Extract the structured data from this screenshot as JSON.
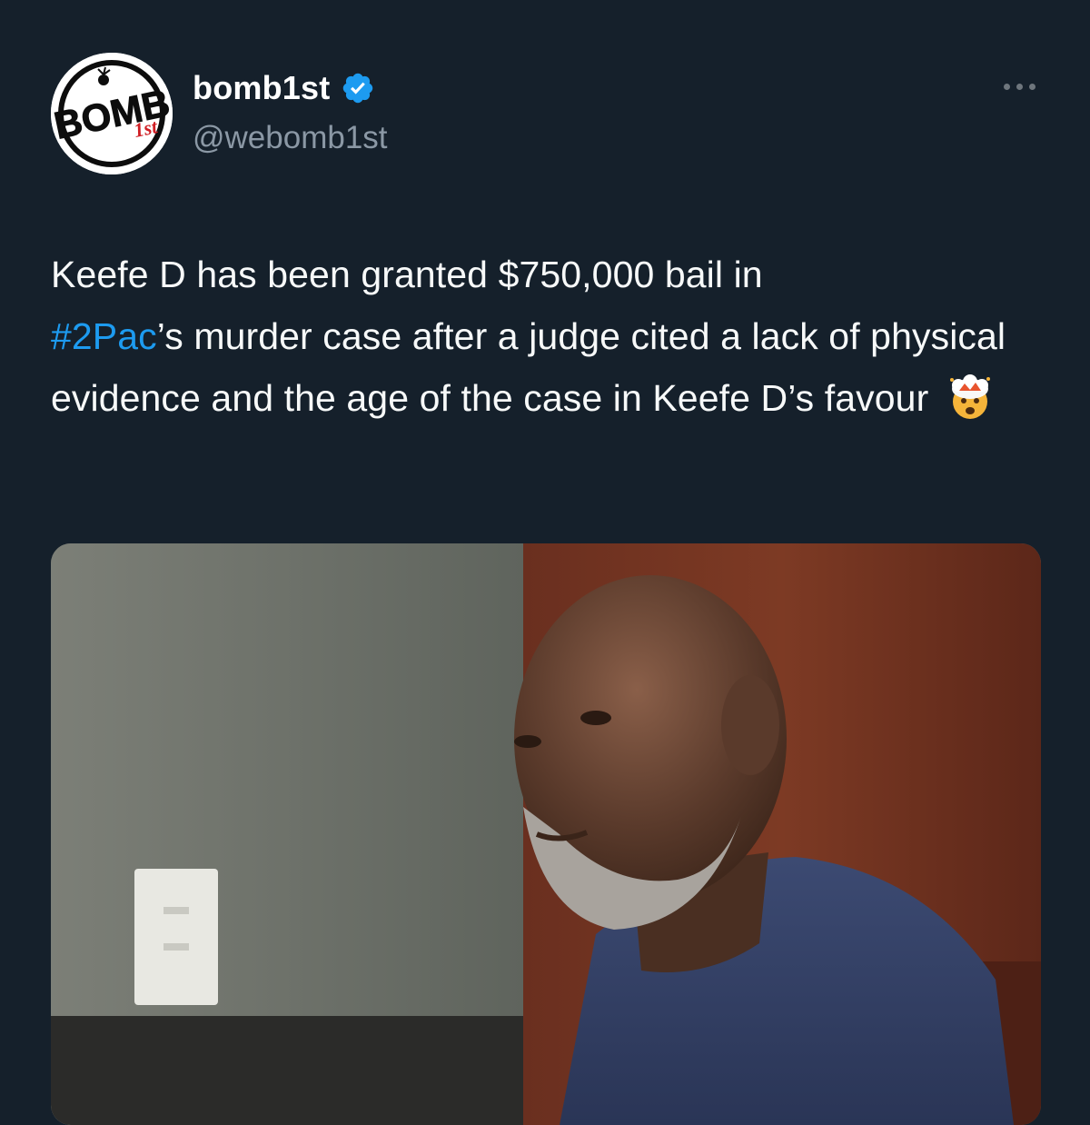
{
  "author": {
    "display_name": "bomb1st",
    "handle": "@webomb1st",
    "verified": true,
    "avatar_icon": "bomb1st-logo-icon",
    "avatar_logo_text": "BOMB",
    "avatar_logo_subtext": "1st"
  },
  "tweet": {
    "text_line1": "Keefe D has been granted $750,000 bail in",
    "hashtag": "#2Pac",
    "text_after_hashtag": "’s murder case after a judge cited a lack of physical evidence and the age of the case in Keefe D’s favour",
    "emoji": "exploding-head-emoji"
  },
  "media": {
    "type": "photo",
    "description_icon": "photo"
  },
  "colors": {
    "background": "#15202b",
    "text": "#f7f9f9",
    "secondary_text": "#8b98a5",
    "link": "#1d9bf0",
    "verified_badge": "#1d9bf0"
  }
}
